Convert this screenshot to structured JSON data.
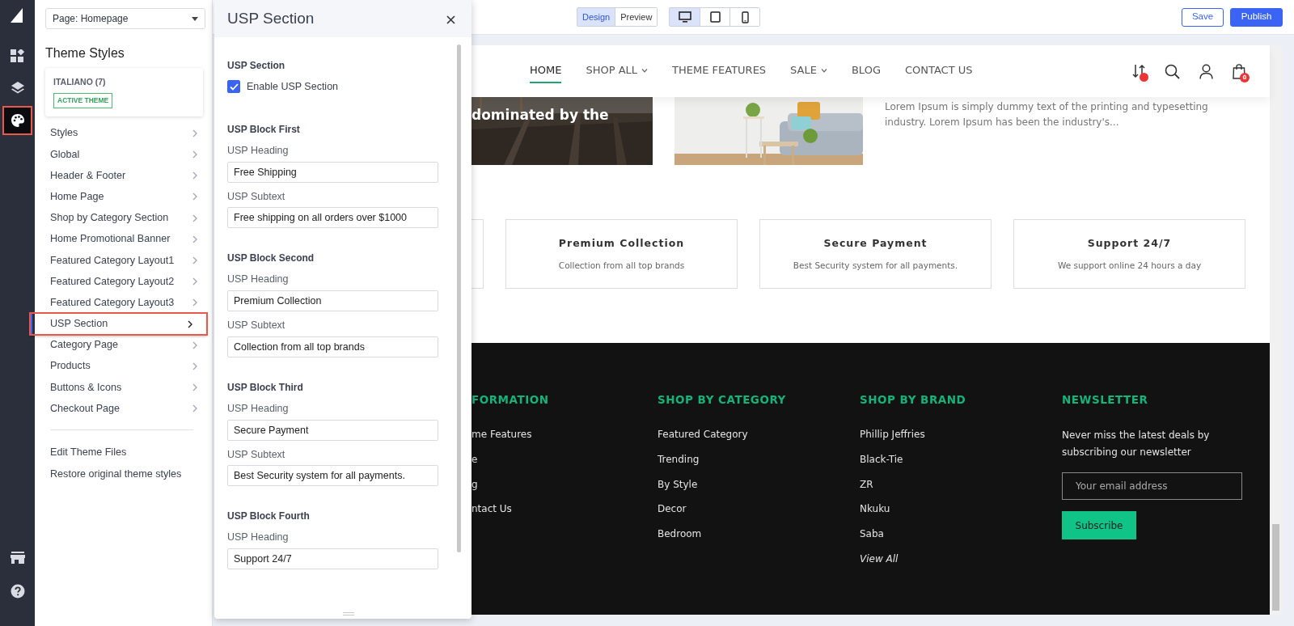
{
  "rail": [
    {
      "kind": "widgets",
      "selected": false,
      "highlighted": false
    },
    {
      "kind": "layers",
      "selected": false,
      "highlighted": false
    },
    {
      "kind": "palette",
      "selected": true,
      "highlighted": true
    }
  ],
  "page_select": {
    "value": "Page: Homepage"
  },
  "theme_styles": {
    "title": "Theme Styles",
    "theme_name": "ITALIANO (7)",
    "badge": "ACTIVE THEME",
    "items": [
      {
        "label": "Styles",
        "selected": false,
        "highlighted": false
      },
      {
        "label": "Global",
        "selected": false,
        "highlighted": false
      },
      {
        "label": "Header & Footer",
        "selected": false,
        "highlighted": false
      },
      {
        "label": "Home Page",
        "selected": false,
        "highlighted": false
      },
      {
        "label": "Shop by Category Section",
        "selected": false,
        "highlighted": false
      },
      {
        "label": "Home Promotional Banner",
        "selected": false,
        "highlighted": false
      },
      {
        "label": "Featured Category Layout1",
        "selected": false,
        "highlighted": false
      },
      {
        "label": "Featured Category Layout2",
        "selected": false,
        "highlighted": false
      },
      {
        "label": "Featured Category Layout3",
        "selected": false,
        "highlighted": false
      },
      {
        "label": "USP Section",
        "selected": true,
        "highlighted": true
      },
      {
        "label": "Category Page",
        "selected": false,
        "highlighted": false
      },
      {
        "label": "Products",
        "selected": false,
        "highlighted": false
      },
      {
        "label": "Buttons & Icons",
        "selected": false,
        "highlighted": false
      },
      {
        "label": "Checkout Page",
        "selected": false,
        "highlighted": false
      }
    ],
    "links": [
      "Edit Theme Files",
      "Restore original theme styles"
    ]
  },
  "panel": {
    "title": "USP Section",
    "section_label": "USP Section",
    "enable": {
      "label": "Enable USP Section",
      "checked": true
    },
    "blocks": [
      {
        "title": "USP Block First",
        "fields": [
          {
            "label": "USP Heading",
            "value": "Free Shipping"
          },
          {
            "label": "USP Subtext",
            "value": "Free shipping on all orders over $1000"
          }
        ]
      },
      {
        "title": "USP Block Second",
        "fields": [
          {
            "label": "USP Heading",
            "value": "Premium Collection"
          },
          {
            "label": "USP Subtext",
            "value": "Collection from all top brands"
          }
        ]
      },
      {
        "title": "USP Block Third",
        "fields": [
          {
            "label": "USP Heading",
            "value": "Secure Payment"
          },
          {
            "label": "USP Subtext",
            "value": "Best Security system for all payments."
          }
        ]
      },
      {
        "title": "USP Block Fourth",
        "fields": [
          {
            "label": "USP Heading",
            "value": "Support 24/7"
          }
        ]
      }
    ]
  },
  "toolbar": {
    "modes": [
      {
        "label": "Design",
        "selected": true
      },
      {
        "label": "Preview",
        "selected": false
      }
    ],
    "devices": [
      {
        "kind": "desktop",
        "selected": true
      },
      {
        "kind": "tablet",
        "selected": false
      },
      {
        "kind": "mobile",
        "selected": false
      }
    ],
    "save": "Save",
    "publish": "Publish"
  },
  "preview": {
    "nav": [
      {
        "label": "HOME",
        "selected": true,
        "dropdown": false
      },
      {
        "label": "SHOP ALL",
        "selected": false,
        "dropdown": true
      },
      {
        "label": "THEME FEATURES",
        "selected": false,
        "dropdown": false
      },
      {
        "label": "SALE",
        "selected": false,
        "dropdown": true
      },
      {
        "label": "BLOG",
        "selected": false,
        "dropdown": false
      },
      {
        "label": "CONTACT US",
        "selected": false,
        "dropdown": false
      }
    ],
    "cart_count": "0",
    "banner_text": "dominated by the",
    "lorem": "Lorem Ipsum is simply dummy text of the printing and typesetting industry. Lorem Ipsum has been the industry's...",
    "usp": [
      {
        "heading": "Premium Collection",
        "text": "Collection from all top brands"
      },
      {
        "heading": "Secure Payment",
        "text": "Best Security system for all payments."
      },
      {
        "heading": "Support 24/7",
        "text": "We support online 24 hours a day"
      }
    ],
    "footer": [
      {
        "title": "FORMATION",
        "links": [
          "me Features",
          "e",
          "g",
          "ntact Us"
        ]
      },
      {
        "title": "SHOP BY CATEGORY",
        "links": [
          "Featured Category",
          "Trending",
          "By Style",
          "Decor",
          "Bedroom"
        ]
      },
      {
        "title": "SHOP BY BRAND",
        "links": [
          "Phillip Jeffries",
          "Black-Tie",
          "ZR",
          "Nkuku",
          "Saba"
        ],
        "view_all": "View All"
      }
    ],
    "newsletter": {
      "title": "NEWSLETTER",
      "text": "Never miss the latest deals by subscribing our newsletter",
      "placeholder": "Your email address",
      "button": "Subscribe"
    }
  }
}
